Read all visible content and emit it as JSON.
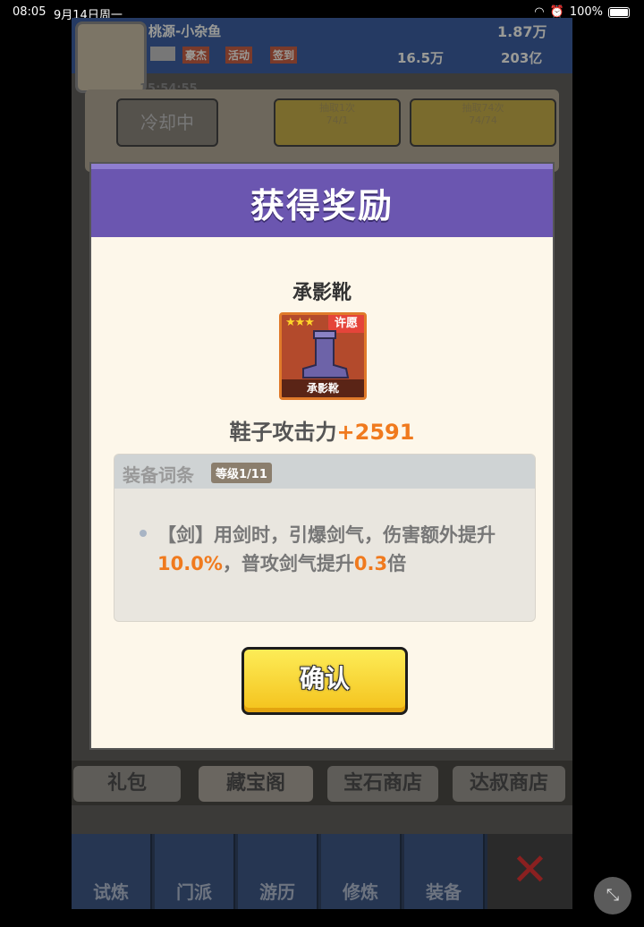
{
  "status_bar": {
    "time": "08:05",
    "date": "9月14日周一",
    "battery": "100%"
  },
  "game": {
    "player_name": "桃源-小杂鱼",
    "menu": [
      "豪杰",
      "活动",
      "签到"
    ],
    "currency_gem": "1.87万",
    "currency_red": "16.5万",
    "currency_gold": "203亿",
    "timer": "15:54:55",
    "cooldown_label": "冷却中",
    "draw_once_label": "抽取1次",
    "draw_once_count": "74/1",
    "draw_74_label": "抽取74次",
    "draw_74_count": "74/74",
    "shop_tabs": [
      "礼包",
      "藏宝阁",
      "宝石商店",
      "达叔商店"
    ],
    "nav": [
      "试炼",
      "门派",
      "游历",
      "修炼",
      "装备"
    ]
  },
  "dialog": {
    "title": "获得奖励",
    "item_name": "承影靴",
    "item_caption": "承影靴",
    "item_badge": "许愿",
    "item_stars": "★★★",
    "stat_name": "鞋子攻击力",
    "stat_value": "+2591",
    "affix_label": "装备词条",
    "affix_level": "等级1/11",
    "affix_desc_1": "【剑】用剑时，引爆剑气，伤害额外提升",
    "affix_pct": "10.0%",
    "affix_desc_2": "，普攻剑气提升",
    "affix_mult": "0.3",
    "affix_desc_3": "倍",
    "confirm_label": "确认"
  },
  "colors": {
    "header": "#6b56b0",
    "accent": "#f07a1e",
    "confirm": "#f4c21c"
  }
}
